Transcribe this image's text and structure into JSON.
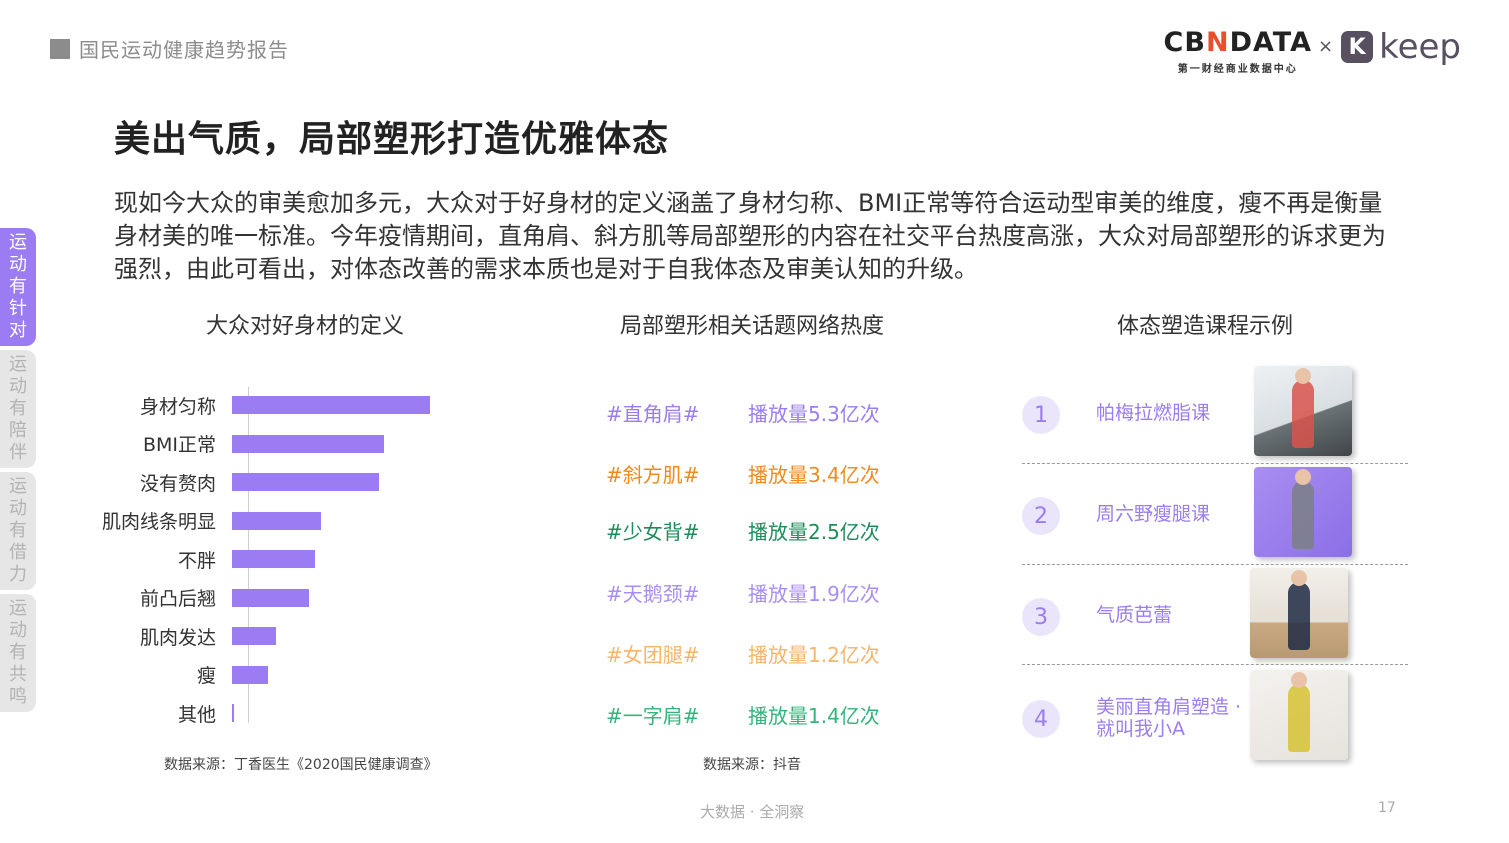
{
  "header": {
    "report_name": "国民运动健康趋势报告",
    "logo_cbndata_main_a": "CB",
    "logo_cbndata_main_n": "N",
    "logo_cbndata_main_b": "DATA",
    "logo_cbndata_sub": "第一财经商业数据中心",
    "logo_times": "×",
    "logo_keep_mark": "K",
    "logo_keep_word": "keep"
  },
  "sidebar": {
    "tabs": [
      {
        "label": [
          "运",
          "动",
          "有",
          "针",
          "对"
        ],
        "active": true
      },
      {
        "label": [
          "运",
          "动",
          "有",
          "陪",
          "伴"
        ],
        "active": false
      },
      {
        "label": [
          "运",
          "动",
          "有",
          "借",
          "力"
        ],
        "active": false
      },
      {
        "label": [
          "运",
          "动",
          "有",
          "共",
          "鸣"
        ],
        "active": false
      }
    ]
  },
  "title": "美出气质，局部塑形打造优雅体态",
  "intro": "现如今大众的审美愈加多元，大众对于好身材的定义涵盖了身材匀称、BMI正常等符合运动型审美的维度，瘦不再是衡量身材美的唯一标准。今年疫情期间，直角肩、斜方肌等局部塑形的内容在社交平台热度高涨，大众对局部塑形的诉求更为强烈，由此可看出，对体态改善的需求本质也是对于自我体态及审美认知的升级。",
  "left_section": {
    "title": "大众对好身材的定义",
    "source": "数据来源：丁香医生《2020国民健康调查》"
  },
  "chart_data": {
    "type": "bar",
    "orientation": "horizontal",
    "categories": [
      "身材匀称",
      "BMI正常",
      "没有赘肉",
      "肌肉线条明显",
      "不胖",
      "前凸后翘",
      "肌肉发达",
      "瘦",
      "其他"
    ],
    "values": [
      100,
      77,
      74,
      45,
      42,
      39,
      22,
      18,
      1
    ],
    "color": "#9b7cf2",
    "xlabel": "",
    "ylabel": "",
    "grid": false
  },
  "middle_section": {
    "title": "局部塑形相关话题网络热度",
    "source": "数据来源：抖音",
    "topics": [
      {
        "tag": "#直角肩#",
        "plays": "播放量5.3亿次",
        "color": "#9b7cf2"
      },
      {
        "tag": "#斜方肌#",
        "plays": "播放量3.4亿次",
        "color": "#f08a1c"
      },
      {
        "tag": "#少女背#",
        "plays": "播放量2.5亿次",
        "color": "#1e8c5a"
      },
      {
        "tag": "#天鹅颈#",
        "plays": "播放量1.9亿次",
        "color": "#a98ef2"
      },
      {
        "tag": "#女团腿#",
        "plays": "播放量1.2亿次",
        "color": "#f5b56a"
      },
      {
        "tag": "#一字肩#",
        "plays": "播放量1.4亿次",
        "color": "#32b47a"
      }
    ]
  },
  "right_section": {
    "title": "体态塑造课程示例",
    "courses": [
      {
        "num": "1",
        "name": "帕梅拉燃脂课"
      },
      {
        "num": "2",
        "name": "周六野瘦腿课"
      },
      {
        "num": "3",
        "name": "气质芭蕾"
      },
      {
        "num": "4",
        "name": "美丽直角肩塑造 ·\n就叫我小A"
      }
    ]
  },
  "footer": {
    "text": "大数据 · 全洞察",
    "page": "17"
  }
}
